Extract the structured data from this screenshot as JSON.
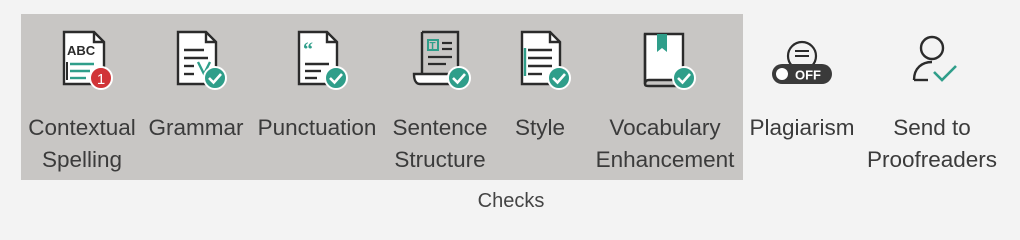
{
  "colors": {
    "selected_bg": "#c8c6c4",
    "accent_teal": "#2f9e8a",
    "badge_red": "#d13438",
    "icon_stroke": "#2b2b2b",
    "toggle_dark": "#3a3a3a"
  },
  "checks": {
    "group_label": "Checks",
    "buttons": [
      {
        "id": "contextual-spelling",
        "label_lines": [
          "Contextual",
          "Spelling"
        ],
        "icon": "abc-document-icon",
        "badge": "1",
        "selected": true
      },
      {
        "id": "grammar",
        "label_lines": [
          "Grammar",
          ""
        ],
        "icon": "grammar-document-icon",
        "status": "checkmark",
        "selected": true
      },
      {
        "id": "punctuation",
        "label_lines": [
          "Punctuation",
          ""
        ],
        "icon": "punctuation-document-icon",
        "status": "checkmark",
        "selected": true
      },
      {
        "id": "sentence-structure",
        "label_lines": [
          "Sentence",
          "Structure"
        ],
        "icon": "scroll-document-icon",
        "status": "checkmark",
        "selected": true
      },
      {
        "id": "style",
        "label_lines": [
          "Style",
          ""
        ],
        "icon": "style-document-icon",
        "status": "checkmark",
        "selected": true
      },
      {
        "id": "vocabulary-enhancement",
        "label_lines": [
          "Vocabulary",
          "Enhancement"
        ],
        "icon": "book-icon",
        "status": "checkmark",
        "selected": true
      },
      {
        "id": "plagiarism",
        "label_lines": [
          "Plagiarism",
          ""
        ],
        "icon": "plagiarism-icon",
        "toggle_label": "OFF",
        "selected": false
      },
      {
        "id": "send-to-proofreaders",
        "label_lines": [
          "Send to",
          "Proofreaders"
        ],
        "icon": "person-check-icon",
        "selected": false
      }
    ]
  }
}
